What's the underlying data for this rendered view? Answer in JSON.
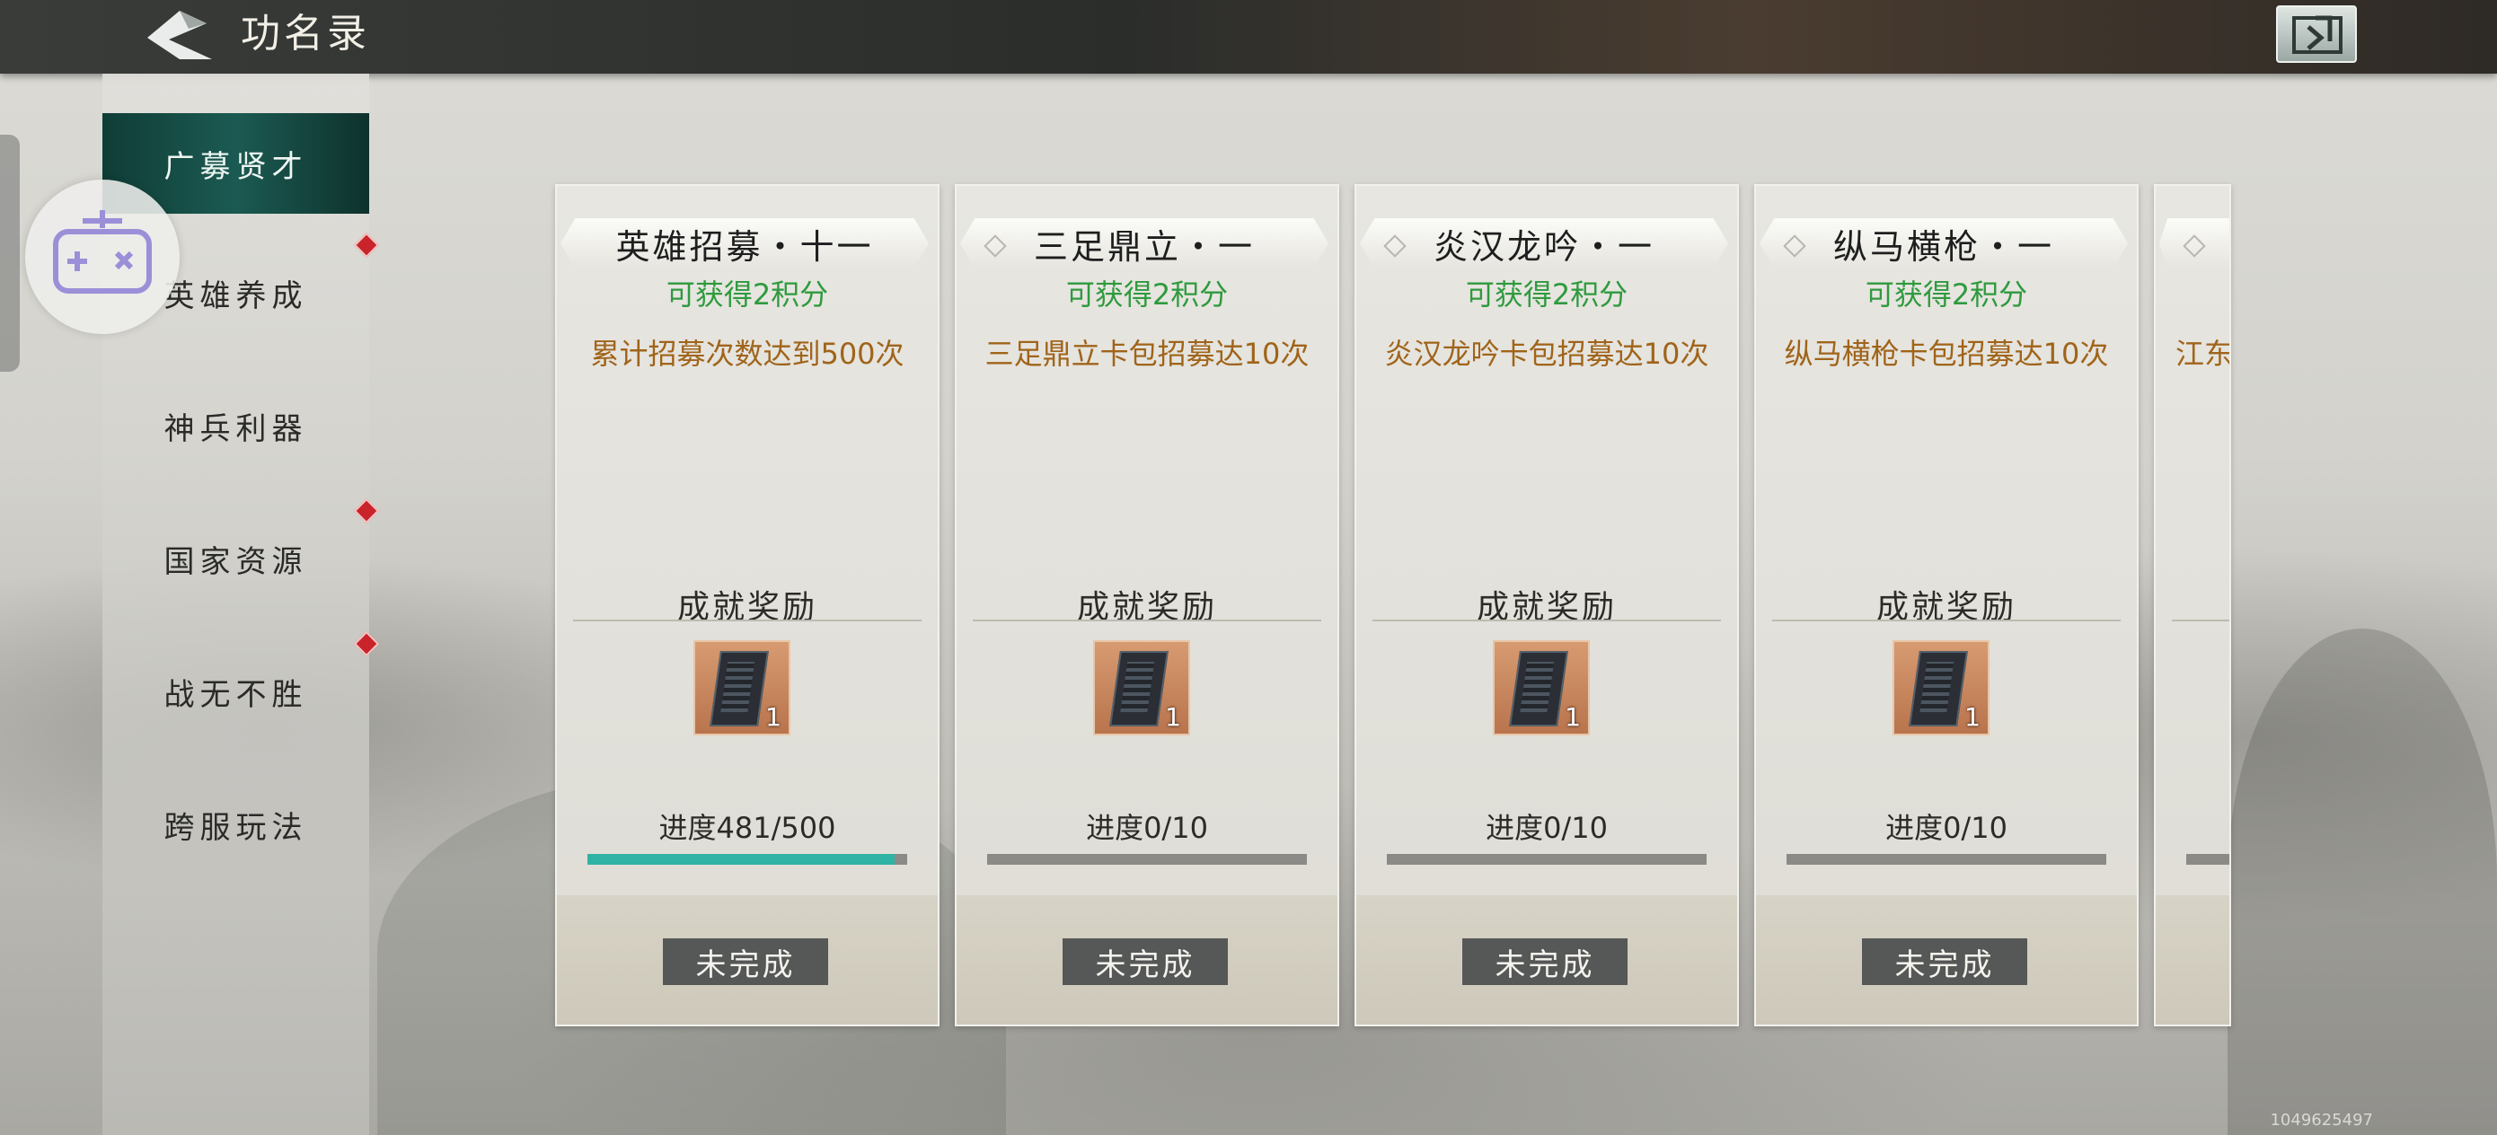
{
  "header": {
    "title": "功名录",
    "back_icon": "back-arrow-icon",
    "exit_icon": "exit-icon"
  },
  "sidebar": {
    "items": [
      {
        "label": "广募贤才",
        "active": true,
        "badge": false
      },
      {
        "label": "英雄养成",
        "active": false,
        "badge": true
      },
      {
        "label": "神兵利器",
        "active": false,
        "badge": false
      },
      {
        "label": "国家资源",
        "active": false,
        "badge": true
      },
      {
        "label": "战无不胜",
        "active": false,
        "badge": true
      },
      {
        "label": "跨服玩法",
        "active": false,
        "badge": false
      }
    ]
  },
  "float_button": {
    "icon": "gamepad-icon"
  },
  "cards": [
    {
      "title": "英雄招募・十一",
      "points": "可获得2积分",
      "condition": "累计招募次数达到500次",
      "reward_title": "成就奖励",
      "reward_qty": "1",
      "progress": "进度481/500",
      "progress_fraction": 0.962,
      "status": "未完成"
    },
    {
      "title": "三足鼎立・一",
      "points": "可获得2积分",
      "condition": "三足鼎立卡包招募达10次",
      "reward_title": "成就奖励",
      "reward_qty": "1",
      "progress": "进度0/10",
      "progress_fraction": 0,
      "status": "未完成"
    },
    {
      "title": "炎汉龙吟・一",
      "points": "可获得2积分",
      "condition": "炎汉龙吟卡包招募达10次",
      "reward_title": "成就奖励",
      "reward_qty": "1",
      "progress": "进度0/10",
      "progress_fraction": 0,
      "status": "未完成"
    },
    {
      "title": "纵马横枪・一",
      "points": "可获得2积分",
      "condition": "纵马横枪卡包招募达10次",
      "reward_title": "成就奖励",
      "reward_qty": "1",
      "progress": "进度0/10",
      "progress_fraction": 0,
      "status": "未完成"
    }
  ],
  "partial_card": {
    "condition": "江东"
  },
  "watermark": "1049625497",
  "colors": {
    "accent": "#2fb3a5",
    "points": "#2f9a3e",
    "condition": "#a0641a",
    "active_tab": "#1b5a52",
    "badge": "#c8242a"
  }
}
